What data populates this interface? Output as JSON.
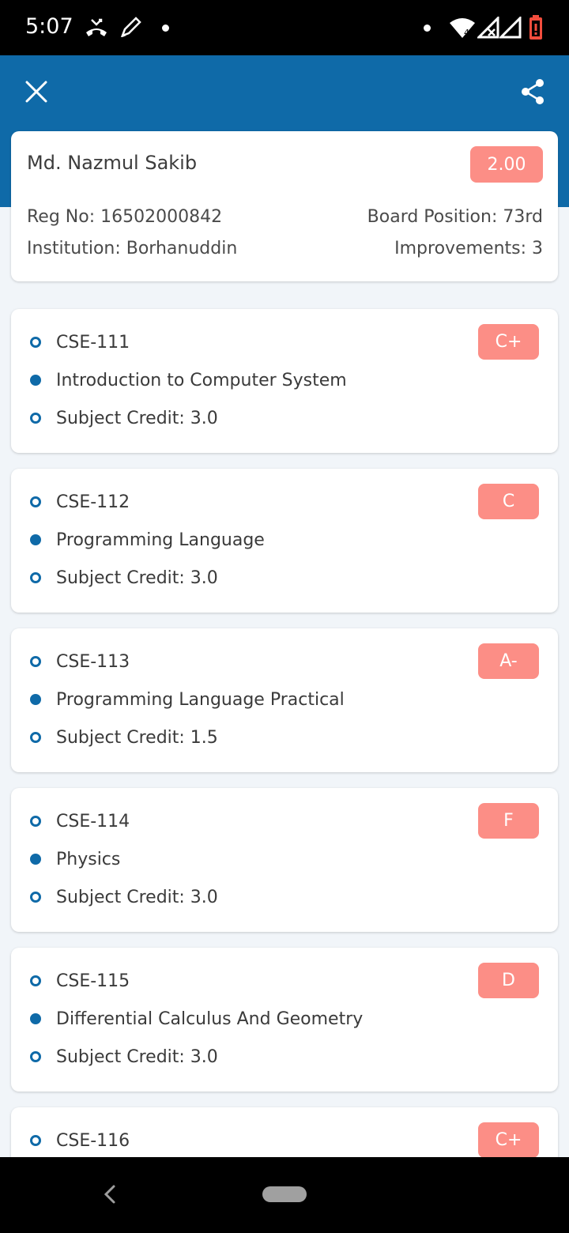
{
  "status_bar": {
    "time": "5:07",
    "icons": [
      "missed-call-icon",
      "pen-icon",
      "dot-icon",
      "wifi-icon",
      "signal-icon",
      "signal-icon",
      "battery-low-icon"
    ]
  },
  "app_bar": {
    "close_icon": "close-icon",
    "share_icon": "share-icon",
    "color": "#0f6aa8"
  },
  "student": {
    "name": "Md. Nazmul Sakib",
    "gpa": "2.00",
    "reg_no": "Reg No: 16502000842",
    "board_position": "Board Position: 73rd",
    "institution": "Institution: Borhanuddin",
    "improvements": "Improvements: 3"
  },
  "subjects": [
    {
      "code": "CSE-111",
      "title": "Introduction to Computer System",
      "credit": "Subject Credit: 3.0",
      "grade": "C+"
    },
    {
      "code": "CSE-112",
      "title": "Programming Language",
      "credit": "Subject Credit: 3.0",
      "grade": "C"
    },
    {
      "code": "CSE-113",
      "title": "Programming Language Practical",
      "credit": "Subject Credit: 1.5",
      "grade": "A-"
    },
    {
      "code": "CSE-114",
      "title": "Physics",
      "credit": "Subject Credit: 3.0",
      "grade": "F"
    },
    {
      "code": "CSE-115",
      "title": "Differential Calculus And Geometry",
      "credit": "Subject Credit: 3.0",
      "grade": "D"
    },
    {
      "code": "CSE-116",
      "title": "",
      "credit": "",
      "grade": "C+"
    }
  ],
  "colors": {
    "primary": "#0f6aa8",
    "grade_pill": "#fc8e86",
    "background": "#f1f5f9"
  }
}
